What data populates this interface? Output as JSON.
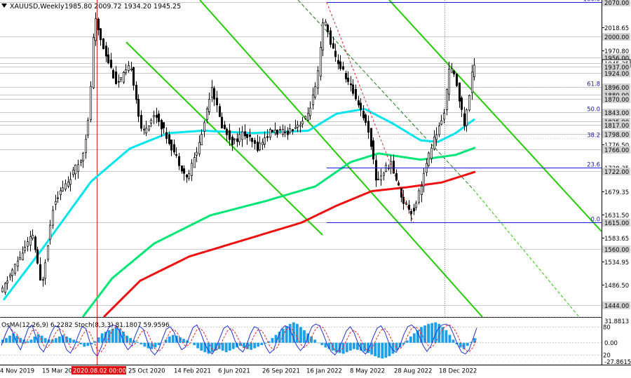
{
  "header": {
    "symbol": "XAUUSD,Weekly",
    "ohlc": "1985.80 2009.72 1934.20 1945.25"
  },
  "colors": {
    "candle": "#000000",
    "ma_fast": "#00e5ee",
    "ma_mid": "#00e676",
    "ma_slow": "#ee1111",
    "trend": "#22cc00",
    "level": "#1a1adc",
    "vline": "#dd2222",
    "osma": "#1ea0e8",
    "stoch_main": "#2233cc",
    "stoch_signal": "#ee2222"
  },
  "chart_data": [
    {
      "type": "candlestick",
      "title": "XAUUSD,Weekly",
      "ylim": [
        1420,
        2075
      ],
      "y_ticks": [
        {
          "value": 2070.0,
          "label": "2070.00",
          "boxed": true
        },
        {
          "value": 2018.65,
          "label": "2018.65",
          "boxed": false
        },
        {
          "value": 2000.0,
          "label": "2000.00",
          "boxed": true
        },
        {
          "value": 1970.8,
          "label": "1970.80",
          "boxed": false
        },
        {
          "value": 1956.0,
          "label": "1956.00",
          "boxed": true
        },
        {
          "value": 1945.25,
          "label": "1945.25",
          "boxed": true,
          "current": true
        },
        {
          "value": 1937.0,
          "label": "1937.00",
          "boxed": true
        },
        {
          "value": 1924.0,
          "label": "1924.00",
          "boxed": true
        },
        {
          "value": 1896.0,
          "label": "1896.00",
          "boxed": true
        },
        {
          "value": 1880.0,
          "label": "1880.00",
          "boxed": true
        },
        {
          "value": 1870.0,
          "label": "1870.00",
          "boxed": true
        },
        {
          "value": 1843.0,
          "label": "1843.00",
          "boxed": true
        },
        {
          "value": 1825.0,
          "label": "1825.00",
          "boxed": true
        },
        {
          "value": 1817.0,
          "label": "1817.00",
          "boxed": true
        },
        {
          "value": 1798.0,
          "label": "1798.00",
          "boxed": true
        },
        {
          "value": 1776.5,
          "label": "1776.50",
          "boxed": false
        },
        {
          "value": 1766.0,
          "label": "1766.00",
          "boxed": true
        },
        {
          "value": 1728.35,
          "label": "1728.35",
          "boxed": false
        },
        {
          "value": 1722.0,
          "label": "1722.00",
          "boxed": true
        },
        {
          "value": 1679.35,
          "label": "1679.35",
          "boxed": false
        },
        {
          "value": 1631.5,
          "label": "1631.50",
          "boxed": false
        },
        {
          "value": 1615.0,
          "label": "1615.00",
          "boxed": true
        },
        {
          "value": 1583.65,
          "label": "1583.65",
          "boxed": false
        },
        {
          "value": 1560.0,
          "label": "1560.00",
          "boxed": true
        },
        {
          "value": 1534.95,
          "label": "1534.95",
          "boxed": false
        },
        {
          "value": 1486.5,
          "label": "1486.50",
          "boxed": false
        },
        {
          "value": 1444.0,
          "label": "1444.00",
          "boxed": true
        }
      ],
      "fibonacci": [
        {
          "label": "100.0",
          "value": 2070.0
        },
        {
          "label": "61.8",
          "value": 1896.0
        },
        {
          "label": "50.0",
          "value": 1843.0
        },
        {
          "label": "38.2",
          "value": 1790.0
        },
        {
          "label": "23.6",
          "value": 1728.0
        },
        {
          "label": "0.0",
          "value": 1615.0
        }
      ],
      "x_labels": [
        "4 Nov 2019",
        "15 Mar 2020",
        "2020.08.02 00:00",
        "25 Oct 2020",
        "14 Feb 2021",
        "6 Jun 2021",
        "26 Sep 2021",
        "16 Jan 2022",
        "8 May 2022",
        "28 Aug 2022",
        "18 Dec 2022"
      ],
      "highlighted_x_label": "2020.08.02 00:00",
      "moving_averages": [
        {
          "color": "ma_fast",
          "anchors": [
            [
              5,
              1455
            ],
            [
              60,
              1560
            ],
            [
              130,
              1700
            ],
            [
              185,
              1768
            ],
            [
              240,
              1800
            ],
            [
              290,
              1805
            ],
            [
              360,
              1800
            ],
            [
              440,
              1805
            ],
            [
              480,
              1840
            ],
            [
              520,
              1850
            ],
            [
              560,
              1820
            ],
            [
              600,
              1785
            ],
            [
              625,
              1782
            ],
            [
              650,
              1800
            ],
            [
              678,
              1830
            ]
          ]
        },
        {
          "color": "ma_mid",
          "anchors": [
            [
              118,
              1420
            ],
            [
              160,
              1500
            ],
            [
              220,
              1572
            ],
            [
              300,
              1630
            ],
            [
              380,
              1660
            ],
            [
              450,
              1690
            ],
            [
              500,
              1740
            ],
            [
              540,
              1758
            ],
            [
              600,
              1745
            ],
            [
              650,
              1755
            ],
            [
              678,
              1770
            ]
          ]
        },
        {
          "color": "ma_slow",
          "anchors": [
            [
              148,
              1420
            ],
            [
              200,
              1495
            ],
            [
              270,
              1545
            ],
            [
              350,
              1580
            ],
            [
              430,
              1615
            ],
            [
              480,
              1650
            ],
            [
              530,
              1680
            ],
            [
              580,
              1688
            ],
            [
              630,
              1698
            ],
            [
              678,
              1720
            ]
          ]
        }
      ],
      "candle_path": [
        [
          5,
          1470
        ],
        [
          15,
          1500
        ],
        [
          30,
          1540
        ],
        [
          50,
          1590
        ],
        [
          62,
          1480
        ],
        [
          80,
          1660
        ],
        [
          100,
          1700
        ],
        [
          120,
          1750
        ],
        [
          130,
          1830
        ],
        [
          138,
          2040
        ],
        [
          150,
          1980
        ],
        [
          170,
          1900
        ],
        [
          190,
          1940
        ],
        [
          205,
          1800
        ],
        [
          225,
          1840
        ],
        [
          250,
          1765
        ],
        [
          270,
          1705
        ],
        [
          290,
          1790
        ],
        [
          305,
          1900
        ],
        [
          318,
          1820
        ],
        [
          335,
          1780
        ],
        [
          350,
          1800
        ],
        [
          370,
          1770
        ],
        [
          390,
          1805
        ],
        [
          410,
          1800
        ],
        [
          440,
          1830
        ],
        [
          455,
          1900
        ],
        [
          465,
          2040
        ],
        [
          480,
          1960
        ],
        [
          495,
          1920
        ],
        [
          515,
          1860
        ],
        [
          530,
          1800
        ],
        [
          540,
          1700
        ],
        [
          560,
          1740
        ],
        [
          578,
          1660
        ],
        [
          592,
          1635
        ],
        [
          605,
          1700
        ],
        [
          620,
          1780
        ],
        [
          635,
          1830
        ],
        [
          645,
          1940
        ],
        [
          655,
          1900
        ],
        [
          665,
          1815
        ],
        [
          672,
          1870
        ],
        [
          678,
          1945
        ]
      ]
    },
    {
      "type": "line",
      "title": "OsMA(12,26,9) 6.2282  Stoch(8,3,3) 81.1807 59.9596",
      "ylim": [
        -27.8615,
        31.8813
      ],
      "y_ticks": [
        {
          "value": 31.8813,
          "label": "31.8813"
        },
        {
          "value": 0.0,
          "label": "0.00"
        },
        {
          "value": -27.8615,
          "label": "-27.8615"
        }
      ],
      "stoch_levels": [
        "80",
        "20"
      ],
      "osma": [
        4,
        6,
        9,
        12,
        9,
        6,
        4,
        2,
        4,
        8,
        11,
        9,
        6,
        4,
        4,
        6,
        8,
        10,
        8,
        6,
        4,
        2,
        -2,
        -5,
        -4,
        -2,
        2,
        7,
        12,
        14,
        16,
        18,
        20,
        18,
        14,
        9,
        6,
        3,
        1,
        -2,
        -5,
        -7,
        -8,
        -6,
        -3,
        0,
        4,
        8,
        10,
        9,
        7,
        5,
        3,
        0,
        -3,
        -7,
        -10,
        -12,
        -14,
        -12,
        -10,
        -8,
        -10,
        -12,
        -10,
        -8,
        -6,
        -4,
        -6,
        -8,
        -9,
        -7,
        -5,
        -3,
        -1,
        2,
        6,
        10,
        14,
        18,
        21,
        24,
        26,
        24,
        20,
        16,
        12,
        8,
        4,
        0,
        -3,
        -6,
        -8,
        -10,
        -12,
        -13,
        -14,
        -12,
        -10,
        -8,
        -9,
        -10,
        -11,
        -13,
        -15,
        -17,
        -19,
        -20,
        -19,
        -17,
        -14,
        -10,
        -6,
        -2,
        3,
        8,
        12,
        16,
        20,
        22,
        24,
        25,
        26,
        24,
        20,
        16,
        10,
        4,
        -2,
        -6,
        -8,
        -4,
        1,
        6
      ],
      "stoch_main": [
        40,
        65,
        85,
        70,
        45,
        30,
        55,
        80,
        88,
        60,
        35,
        25,
        45,
        70,
        86,
        82,
        55,
        30,
        22,
        38,
        62,
        84,
        80,
        50,
        25,
        15,
        35,
        60,
        82,
        88,
        85,
        70,
        45,
        30,
        40,
        65,
        85,
        78,
        52,
        28,
        18,
        30,
        55,
        78,
        84,
        72,
        48,
        30,
        36,
        60,
        82,
        88,
        70,
        45,
        28,
        20,
        35,
        58,
        80,
        86,
        74,
        50,
        32,
        25,
        42,
        68,
        84,
        80,
        58,
        36,
        22,
        30,
        55,
        78,
        86,
        82,
        62,
        40,
        28,
        38,
        62,
        84,
        90,
        86,
        66,
        42,
        26,
        18,
        30,
        52,
        74,
        84,
        70,
        46,
        28,
        20,
        35,
        60,
        80,
        86,
        72,
        48,
        30,
        24,
        40,
        66,
        84,
        88,
        80,
        62,
        40,
        26,
        38,
        62,
        80,
        88,
        90,
        85,
        65,
        42,
        25,
        20,
        30,
        55,
        81
      ]
    }
  ]
}
